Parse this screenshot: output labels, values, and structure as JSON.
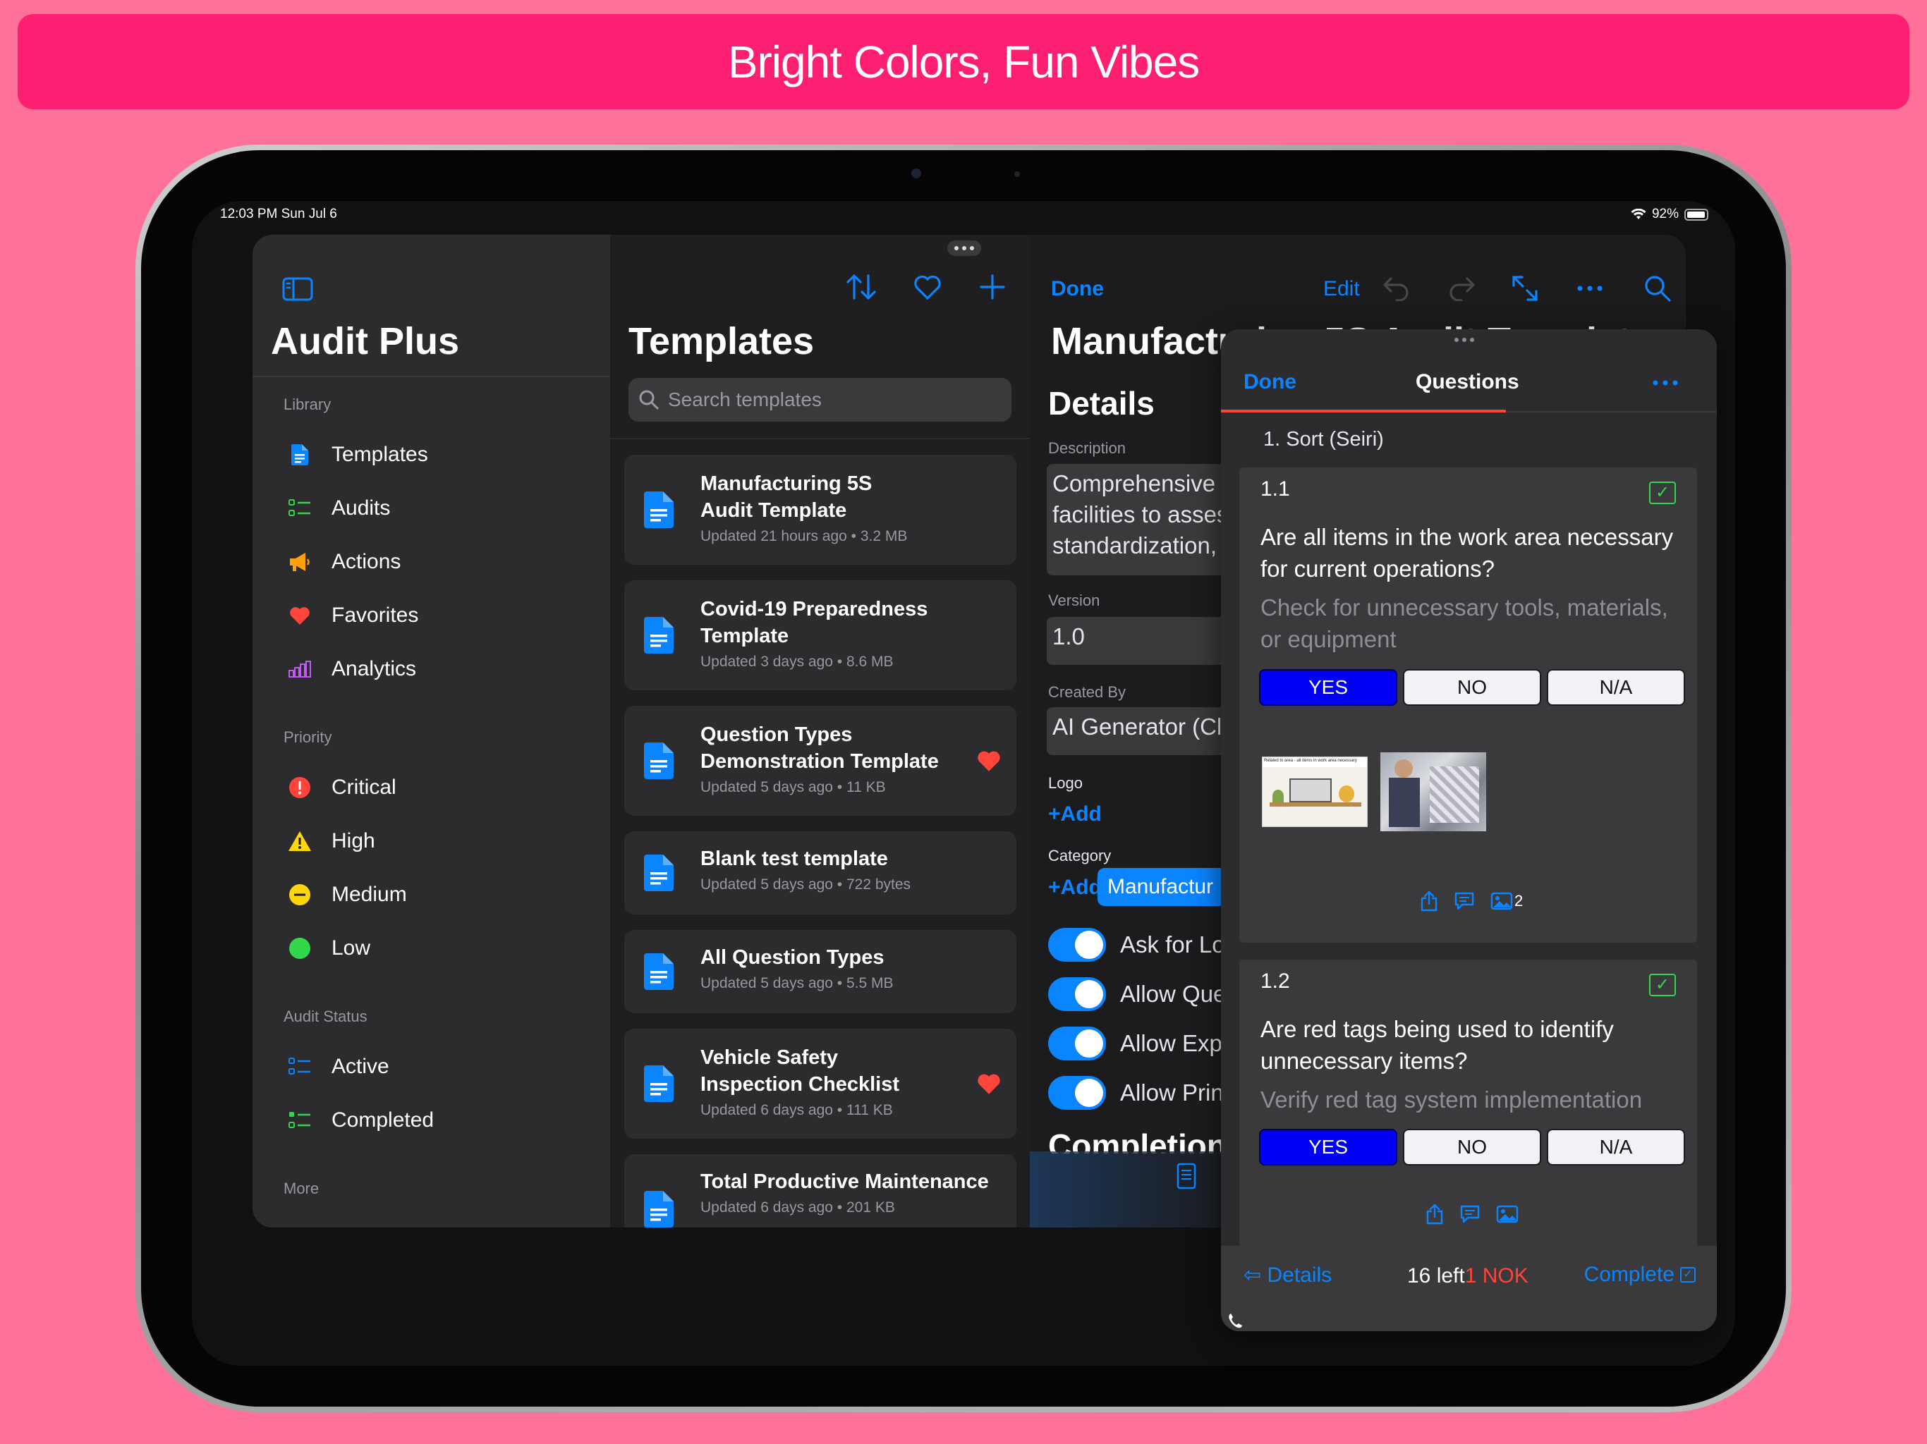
{
  "banner": "Bright Colors, Fun Vibes",
  "status": {
    "time": "12:03 PM   Sun Jul 6",
    "battery": "92%"
  },
  "sidebar": {
    "title": "Audit Plus",
    "sections": [
      {
        "label": "Library",
        "items": [
          "Templates",
          "Audits",
          "Actions",
          "Favorites",
          "Analytics"
        ]
      },
      {
        "label": "Priority",
        "items": [
          "Critical",
          "High",
          "Medium",
          "Low"
        ]
      },
      {
        "label": "Audit Status",
        "items": [
          "Active",
          "Completed"
        ]
      },
      {
        "label": "More",
        "items": []
      }
    ],
    "colors": {
      "critical": "#ff453a",
      "high": "#ff9f0a",
      "medium": "#ffd60a",
      "low": "#32d74b",
      "analytics": "#bf5af2"
    }
  },
  "templates": {
    "title": "Templates",
    "search_placeholder": "Search templates",
    "items": [
      {
        "title": "Manufacturing 5S\nAudit Template",
        "subtitle": "Updated 21 hours ago • 3.2 MB",
        "favorite": false
      },
      {
        "title": "Covid-19 Preparedness\nTemplate",
        "subtitle": "Updated 3 days ago • 8.6 MB",
        "favorite": false
      },
      {
        "title": "Question Types\nDemonstration Template",
        "subtitle": "Updated 5 days ago • 11 KB",
        "favorite": true
      },
      {
        "title": "Blank test template",
        "subtitle": "Updated 5 days ago • 722 bytes",
        "favorite": false
      },
      {
        "title": "All Question Types",
        "subtitle": "Updated 5 days ago • 5.5 MB",
        "favorite": false
      },
      {
        "title": "Vehicle Safety\nInspection Checklist",
        "subtitle": "Updated 6 days ago • 111 KB",
        "favorite": true
      },
      {
        "title": "Total Productive Maintenance",
        "subtitle": "Updated 6 days ago • 201 KB",
        "favorite": false
      }
    ]
  },
  "detail": {
    "done": "Done",
    "edit": "Edit",
    "title": "Manufacturing 5S Audit Template",
    "section": "Details",
    "description_label": "Description",
    "description": "Comprehensive\nfacilities to asses\nstandardization,",
    "version_label": "Version",
    "version": "1.0",
    "created_by_label": "Created By",
    "created_by": "AI Generator (Cla",
    "logo_label": "Logo",
    "add": "Add",
    "category_label": "Category",
    "category": "Manufactur",
    "toggles": [
      "Ask for Lo",
      "Allow Que",
      "Allow Exp",
      "Allow Prin"
    ],
    "completion": "Completion"
  },
  "questions_sheet": {
    "done": "Done",
    "title": "Questions",
    "section": "1. Sort (Seiri)",
    "questions": [
      {
        "num": "1.1",
        "text": "Are all items in the work area necessary for current operations?",
        "hint": "Check for unnecessary tools, materials, or equipment",
        "answer": "YES",
        "photo_count": "2",
        "photo_caption": "Related to area - all items in work area necessary"
      },
      {
        "num": "1.2",
        "text": "Are red tags being used to identify unnecessary items?",
        "hint": "Verify red tag system implementation",
        "answer": "YES"
      }
    ],
    "options": [
      "YES",
      "NO",
      "N/A"
    ],
    "footer": {
      "details": "Details",
      "left": "16 left",
      "nok": "1 NOK",
      "complete": "Complete"
    }
  }
}
